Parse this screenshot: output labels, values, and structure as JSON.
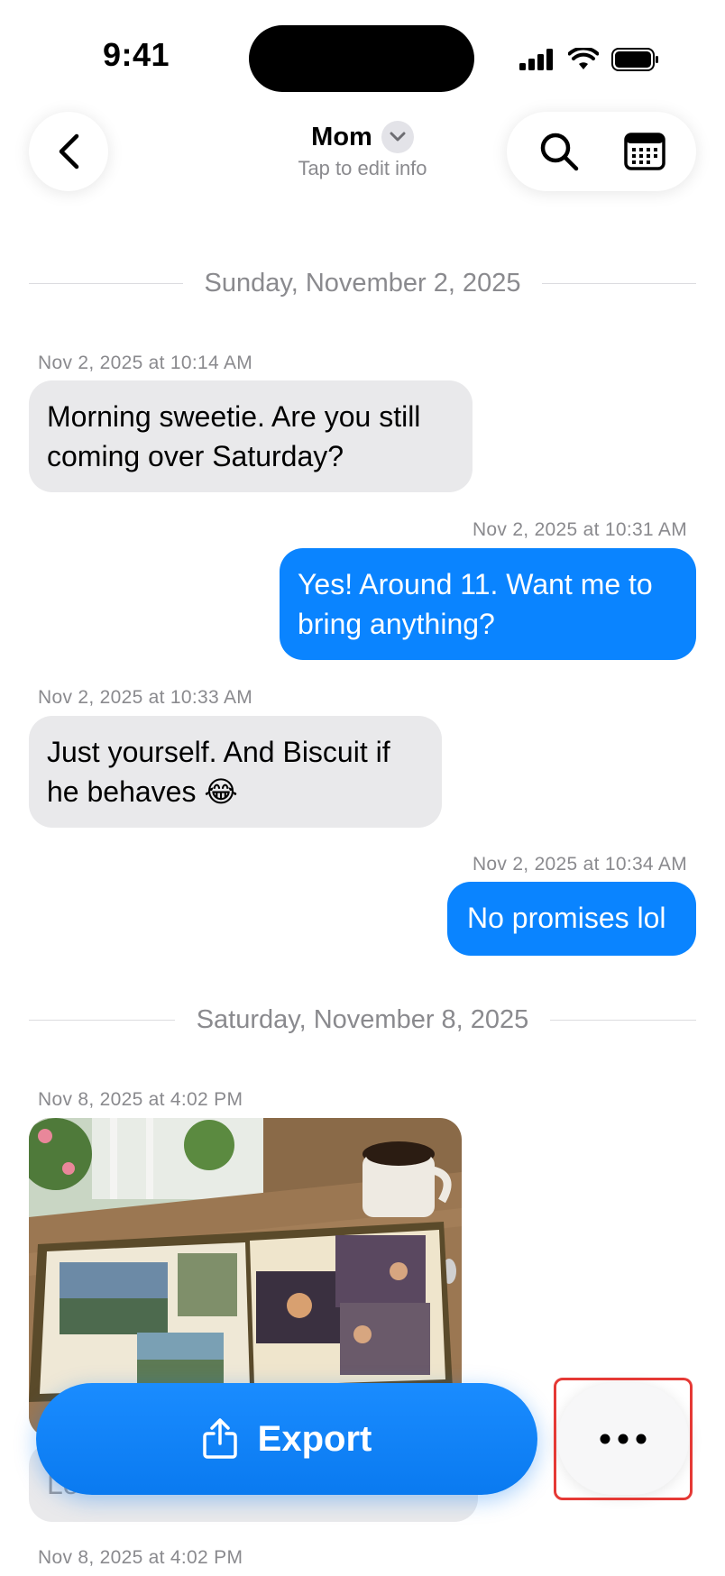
{
  "status_bar": {
    "time": "9:41"
  },
  "header": {
    "contact_name": "Mom",
    "subtitle": "Tap to edit info"
  },
  "sections": [
    {
      "date_label": "Sunday, November 2, 2025"
    },
    {
      "date_label": "Saturday, November 8, 2025"
    }
  ],
  "messages": [
    {
      "timestamp": "Nov 2, 2025 at 10:14 AM",
      "direction": "incoming",
      "text": "Morning sweetie. Are you still coming over Saturday?"
    },
    {
      "timestamp": "Nov 2, 2025 at 10:31 AM",
      "direction": "outgoing",
      "text": "Yes! Around 11. Want me to bring anything?"
    },
    {
      "timestamp": "Nov 2, 2025 at 10:33 AM",
      "direction": "incoming",
      "text": "Just yourself. And Biscuit if he behaves 😂"
    },
    {
      "timestamp": "Nov 2, 2025 at 10:34 AM",
      "direction": "outgoing",
      "text": "No promises lol"
    },
    {
      "timestamp": "Nov 8, 2025 at 4:02 PM",
      "direction": "incoming",
      "type": "photo",
      "text": ""
    },
    {
      "timestamp": "",
      "direction": "incoming",
      "text": "Lo"
    },
    {
      "timestamp": "Nov 8, 2025 at 4:02 PM",
      "direction": "incoming",
      "text": ""
    }
  ],
  "bottom_bar": {
    "export_label": "Export",
    "more_label": "•••"
  },
  "colors": {
    "accent": "#0a84ff",
    "incoming_bubble": "#e9e9eb",
    "highlight": "#e53935"
  }
}
